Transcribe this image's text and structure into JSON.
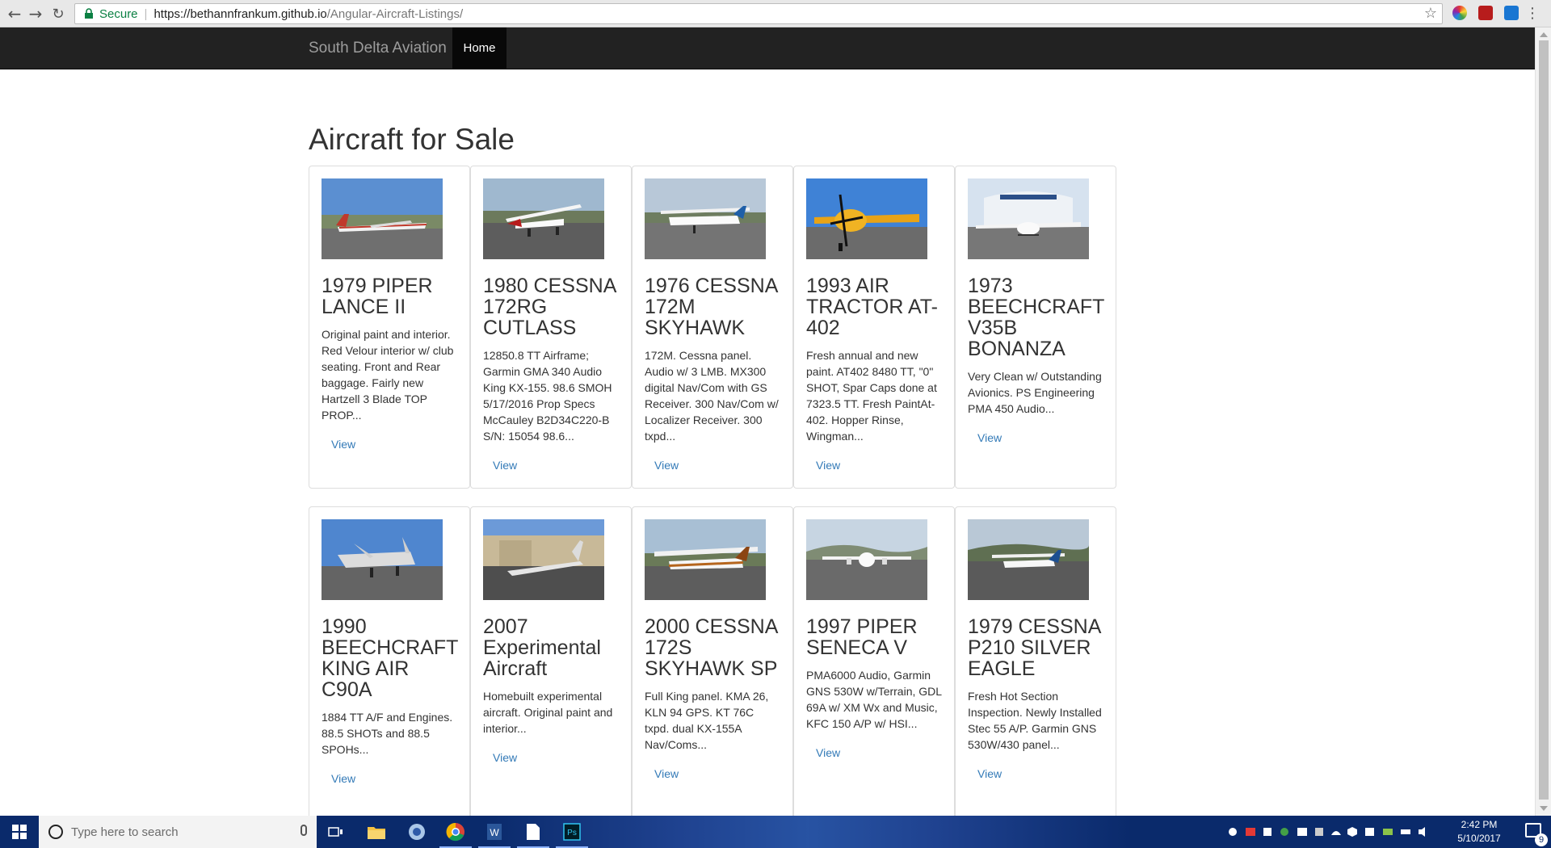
{
  "browser": {
    "secure_label": "Secure",
    "url_host": "https://bethannfrankum.github.io",
    "url_path": "/Angular-Aircraft-Listings/"
  },
  "navbar": {
    "brand": "South Delta Aviation",
    "home": "Home"
  },
  "page": {
    "title": "Aircraft for Sale"
  },
  "listings": [
    {
      "title": "1979 PIPER LANCE II",
      "desc": "Original paint and interior. Red Velour interior w/ club seating. Front and Rear baggage. Fairly new Hartzell 3 Blade TOP PROP...",
      "view": "View"
    },
    {
      "title": "1980 CESSNA 172RG CUTLASS",
      "desc": "12850.8 TT Airframe; Garmin GMA 340 Audio King KX-155. 98.6 SMOH 5/17/2016 Prop Specs McCauley B2D34C220-B S/N: 15054 98.6...",
      "view": "View"
    },
    {
      "title": "1976 CESSNA 172M SKYHAWK",
      "desc": "172M. Cessna panel. Audio w/ 3 LMB. MX300 digital Nav/Com with GS Receiver. 300 Nav/Com w/ Localizer Receiver. 300 txpd...",
      "view": "View"
    },
    {
      "title": "1993 AIR TRACTOR AT-402",
      "desc": "Fresh annual and new paint. AT402 8480 TT, \"0\" SHOT, Spar Caps done at 7323.5 TT. Fresh PaintAt-402. Hopper Rinse, Wingman...",
      "view": "View"
    },
    {
      "title": "1973 BEECHCRAFT V35B BONANZA",
      "desc": "Very Clean w/ Outstanding Avionics. PS Engineering PMA 450 Audio...",
      "view": "View"
    },
    {
      "title": "1990 BEECHCRAFT KING AIR C90A",
      "desc": "1884 TT A/F and Engines. 88.5 SHOTs and 88.5 SPOHs...",
      "view": "View"
    },
    {
      "title": "2007 Experimental Aircraft",
      "desc": "Homebuilt experimental aircraft. Original paint and interior...",
      "view": "View"
    },
    {
      "title": "2000 CESSNA 172S SKYHAWK SP",
      "desc": "Full King panel. KMA 26, KLN 94 GPS. KT 76C txpd. dual KX-155A Nav/Coms...",
      "view": "View"
    },
    {
      "title": "1997 PIPER SENECA V",
      "desc": "PMA6000 Audio, Garmin GNS 530W w/Terrain, GDL 69A w/ XM Wx and Music, KFC 150 A/P w/ HSI...",
      "view": "View"
    },
    {
      "title": "1979 CESSNA P210 SILVER EAGLE",
      "desc": "Fresh Hot Section Inspection. Newly Installed Stec 55 A/P. Garmin GNS 530W/430 panel...",
      "view": "View"
    }
  ],
  "taskbar": {
    "search_placeholder": "Type here to search",
    "time": "2:42 PM",
    "date": "5/10/2017",
    "notification_count": "9"
  },
  "colors": {
    "navbar": "#222222",
    "link": "#337ab7",
    "taskbar": "#0a2a6b"
  }
}
